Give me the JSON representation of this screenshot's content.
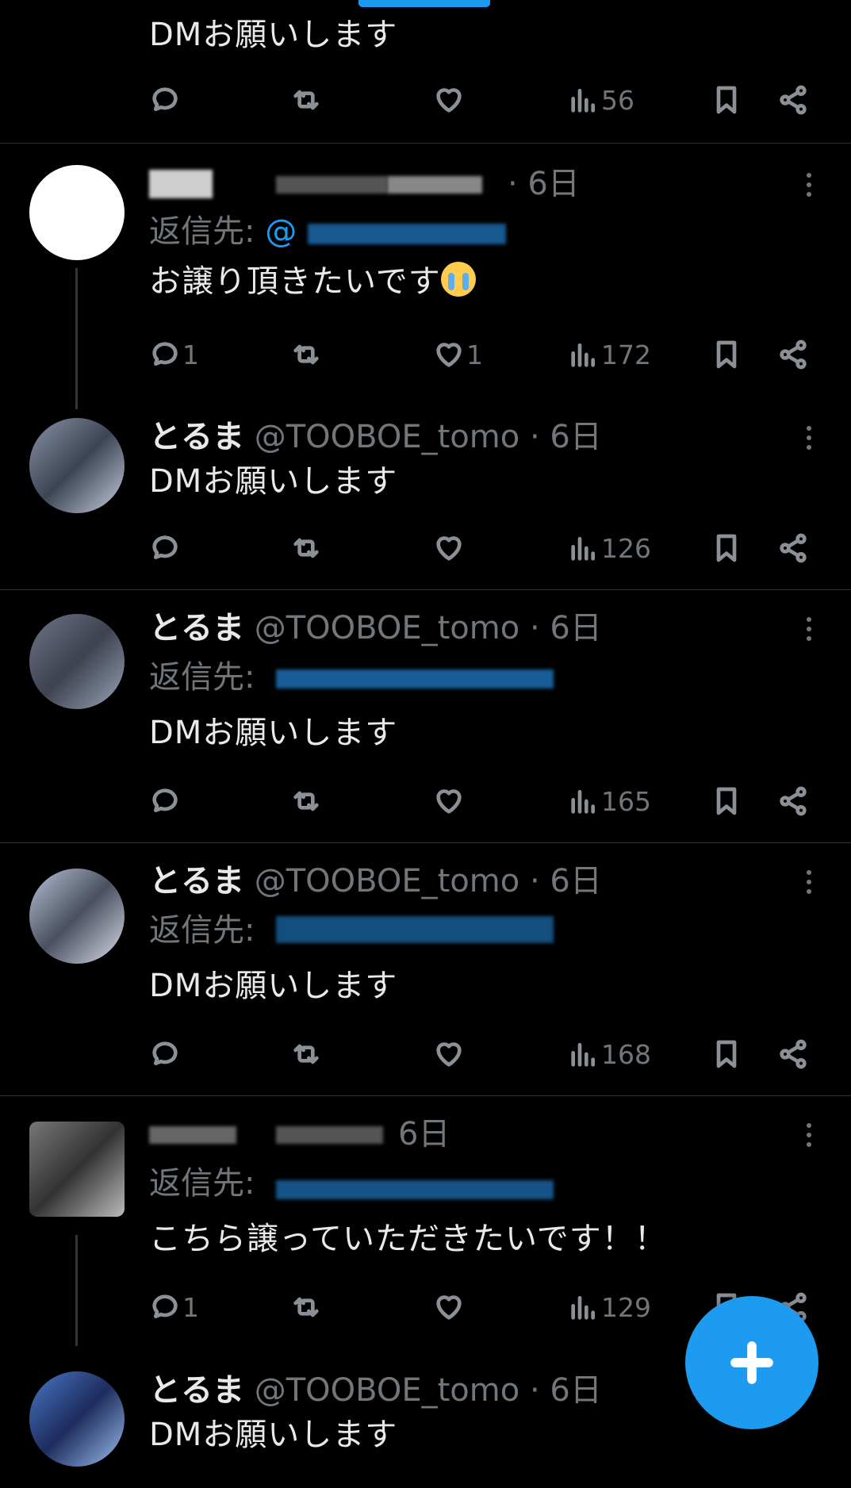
{
  "tweets": [
    {
      "text": "DMお願いします",
      "views": "56"
    },
    {
      "time": "· 6日",
      "reply_label": "返信先:",
      "reply_handle": "@",
      "text": "お譲り頂きたいです",
      "replies": "1",
      "likes": "1",
      "views": "172"
    },
    {
      "name": "とるま",
      "handle": "@TOOBOE_tomo",
      "time": "· 6日",
      "text": "DMお願いします",
      "views": "126"
    },
    {
      "name": "とるま",
      "handle": "@TOOBOE_tomo",
      "time": "· 6日",
      "reply_label": "返信先:",
      "text": "DMお願いします",
      "views": "165"
    },
    {
      "name": "とるま",
      "handle": "@TOOBOE_tomo",
      "time": "· 6日",
      "reply_label": "返信先:",
      "text": "DMお願いします",
      "views": "168"
    },
    {
      "time": "6日",
      "reply_label": "返信先:",
      "text": "こちら譲っていただきたいです！！",
      "replies": "1",
      "views": "129"
    },
    {
      "name": "とるま",
      "handle": "@TOOBOE_tomo",
      "time": "· 6日",
      "text": "DMお願いします"
    }
  ],
  "icons": [
    "reply-icon",
    "retweet-icon",
    "like-icon",
    "views-icon",
    "bookmark-icon",
    "share-icon",
    "more-icon",
    "plus-icon"
  ],
  "colors": {
    "accent": "#1d9bf0",
    "background": "#000000",
    "text": "#e7e9ea",
    "muted": "#71767b"
  }
}
